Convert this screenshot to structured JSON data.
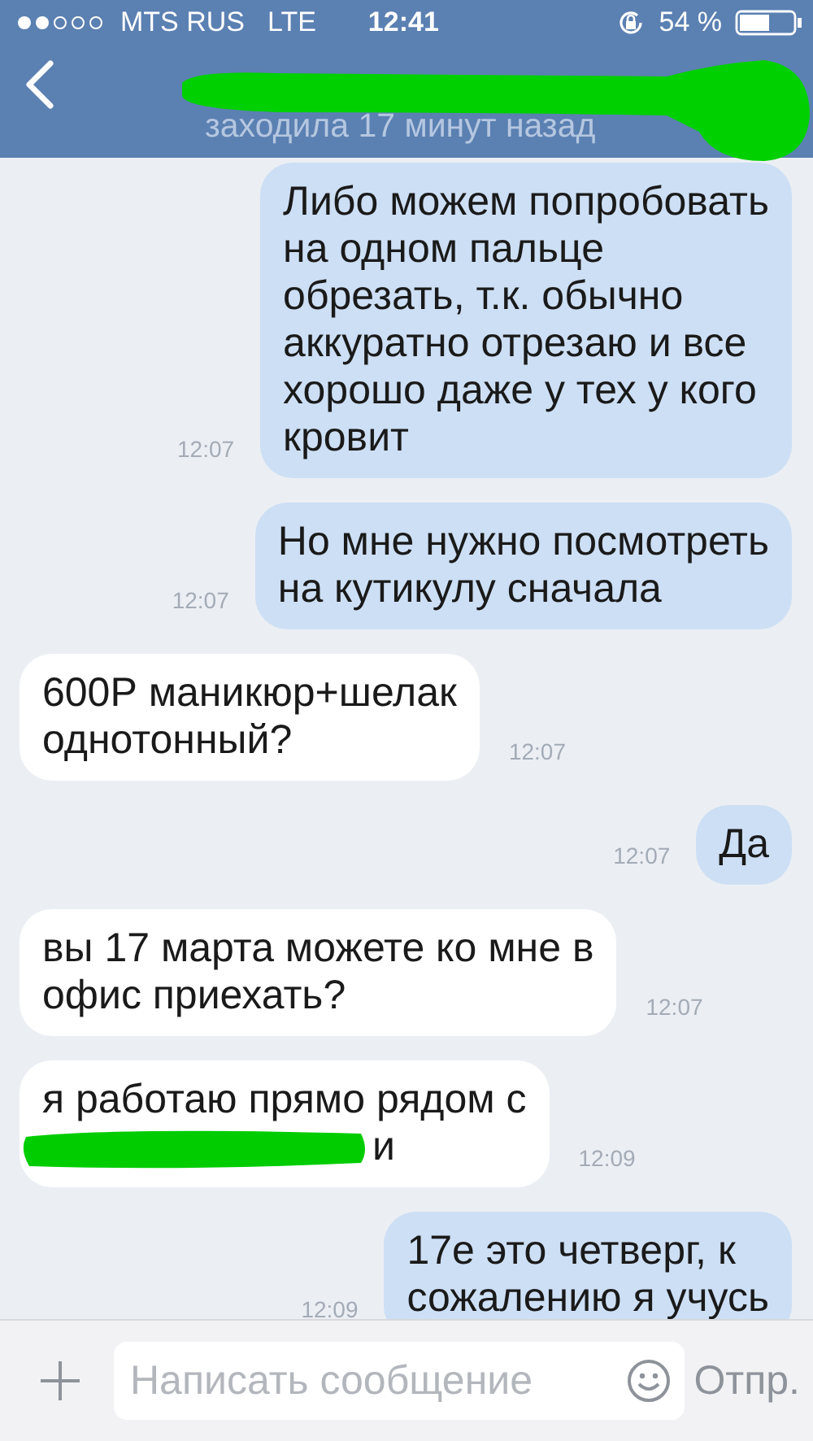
{
  "status_bar": {
    "carrier": "MTS RUS",
    "network": "LTE",
    "time": "12:41",
    "battery": "54 %"
  },
  "header": {
    "title_redacted": true,
    "subtitle": "заходила 17 минут назад"
  },
  "messages": [
    {
      "kind": "outgoing",
      "lines": [
        "Либо можем попробовать",
        "на одном пальце",
        "обрезать, т.к. обычно",
        "аккуратно отрезаю и все",
        "хорошо даже у тех у кого",
        "кровит"
      ],
      "time": "12:07",
      "redaction": false
    },
    {
      "kind": "outgoing",
      "lines": [
        "Но мне нужно посмотреть",
        "на кутикулу сначала"
      ],
      "time": "12:07",
      "redaction": false
    },
    {
      "kind": "incoming",
      "lines": [
        "600Р маникюр+шелак",
        "однотонный?"
      ],
      "time": "12:07",
      "redaction": false
    },
    {
      "kind": "outgoing",
      "lines": [
        "Да"
      ],
      "time": "12:07",
      "redaction": false
    },
    {
      "kind": "incoming",
      "lines": [
        "вы 17 марта можете ко мне в",
        "офис приехать?"
      ],
      "time": "12:07",
      "redaction": false
    },
    {
      "kind": "incoming",
      "lines": [
        "я работаю прямо рядом с",
        "и"
      ],
      "time": "12:09",
      "redaction": true
    },
    {
      "kind": "outgoing",
      "lines": [
        "17е это четверг, к",
        "сожалению я учусь"
      ],
      "time": "12:09",
      "redaction": false
    }
  ],
  "composer": {
    "placeholder": "Написать сообщение",
    "send": "Отпр."
  }
}
